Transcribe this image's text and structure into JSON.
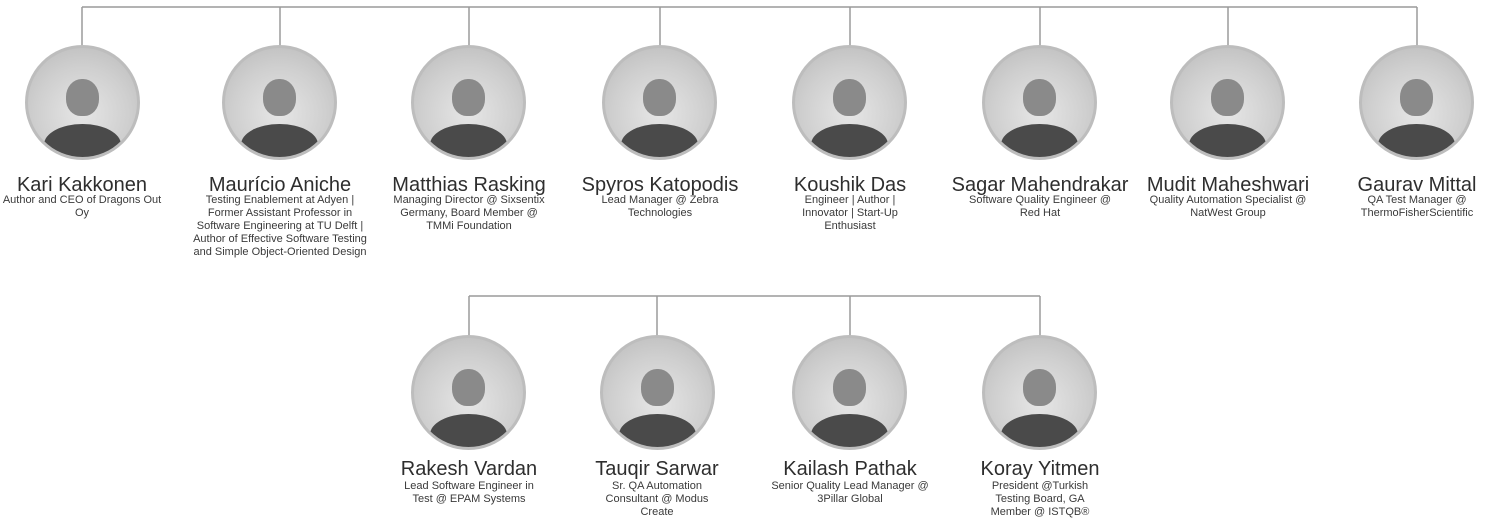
{
  "row1": [
    {
      "name": "Kari Kakkonen",
      "title": "Author and CEO of Dragons Out Oy"
    },
    {
      "name": "Maurício Aniche",
      "title": "Testing Enablement at Adyen | Former Assistant Professor in Software Engineering at TU Delft | Author of Effective Software Testing and Simple Object-Oriented Design"
    },
    {
      "name": "Matthias Rasking",
      "title": "Managing Director @ Sixsentix Germany, Board Member @ TMMi Foundation"
    },
    {
      "name": "Spyros Katopodis",
      "title": "Lead Manager @ Zebra Technologies"
    },
    {
      "name": "Koushik Das",
      "title": "Engineer | Author | Innovator | Start-Up Enthusiast"
    },
    {
      "name": "Sagar Mahendrakar",
      "title": "Software Quality Engineer @ Red Hat"
    },
    {
      "name": "Mudit Maheshwari",
      "title": "Quality Automation Specialist @ NatWest Group"
    },
    {
      "name": "Gaurav Mittal",
      "title": "QA Test Manager @ ThermoFisherScientific"
    }
  ],
  "row2": [
    {
      "name": "Rakesh Vardan",
      "title": "Lead Software Engineer in Test @ EPAM Systems"
    },
    {
      "name": "Tauqir Sarwar",
      "title": "Sr. QA Automation Consultant @ Modus Create"
    },
    {
      "name": "Kailash Pathak",
      "title": "Senior Quality Lead Manager @ 3Pillar Global"
    },
    {
      "name": "Koray Yitmen",
      "title": "President @Turkish Testing Board, GA Member @ ISTQB®"
    }
  ],
  "colors": {
    "line": "#9a9a9a",
    "ring": "#bdbdbd",
    "text": "#2e2e2e"
  }
}
